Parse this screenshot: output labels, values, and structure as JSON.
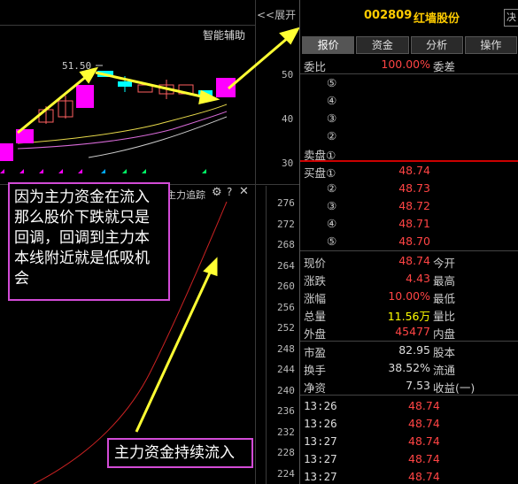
{
  "chart": {
    "expand_label": "<<展开",
    "smart_assist": "智能辅助",
    "price_label": "51.50",
    "kline_axis": [
      "50",
      "40",
      "30"
    ],
    "flow_title": "主力追踪",
    "flow_axis": [
      "276",
      "272",
      "268",
      "264",
      "260",
      "256",
      "252",
      "248",
      "244",
      "240",
      "236",
      "232",
      "228",
      "224"
    ],
    "note1": "因为主力资金在流入那么股价下跌就只是回调，回调到主力本本线附近就是低吸机会",
    "note2": "主力资金持续流入",
    "colors": {
      "note_border": "#d24bd6",
      "up_candle": "#ff00ff",
      "arrow": "#ffff33",
      "flow_line": "#cc2222"
    }
  },
  "quote": {
    "code": "002809",
    "name": "红墙股份",
    "decide": "决",
    "tabs": [
      "报价",
      "资金",
      "分析",
      "操作"
    ],
    "weibi_label": "委比",
    "weibi_value": "100.00%",
    "weicha_label": "委差",
    "sell": [
      "⑤",
      "④",
      "③",
      "②",
      "卖盘①"
    ],
    "buy_label": "买盘①",
    "buy": [
      {
        "n": "",
        "price": "48.74"
      },
      {
        "n": "②",
        "price": "48.73"
      },
      {
        "n": "③",
        "price": "48.72"
      },
      {
        "n": "④",
        "price": "48.71"
      },
      {
        "n": "⑤",
        "price": "48.70"
      }
    ],
    "stats": [
      {
        "l": "现价",
        "v": "48.74",
        "r": "今开"
      },
      {
        "l": "涨跌",
        "v": "4.43",
        "r": "最高"
      },
      {
        "l": "涨幅",
        "v": "10.00%",
        "r": "最低"
      },
      {
        "l": "总量",
        "v": "11.56万",
        "r": "量比"
      },
      {
        "l": "外盘",
        "v": "45477",
        "r": "内盘"
      }
    ],
    "stats2": [
      {
        "l": "市盈",
        "v": "82.95",
        "r": "股本"
      },
      {
        "l": "换手",
        "v": "38.52%",
        "r": "流通"
      },
      {
        "l": "净资",
        "v": "7.53",
        "r": "收益(一)"
      }
    ],
    "ticks": [
      {
        "t": "13:26",
        "p": "48.74"
      },
      {
        "t": "13:26",
        "p": "48.74"
      },
      {
        "t": "13:27",
        "p": "48.74"
      },
      {
        "t": "13:27",
        "p": "48.74"
      },
      {
        "t": "13:27",
        "p": "48.74"
      }
    ]
  }
}
